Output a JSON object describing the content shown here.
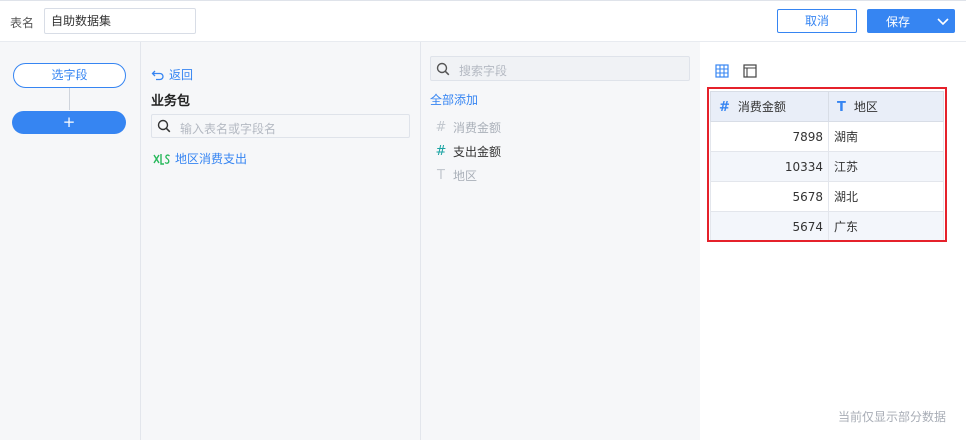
{
  "header": {
    "table_name_label": "表名",
    "table_name_value": "自助数据集",
    "cancel_label": "取消",
    "save_label": "保存"
  },
  "steps": {
    "select_fields_label": "选字段",
    "add_label": "+"
  },
  "package": {
    "back_label": "返回",
    "title": "业务包",
    "search_placeholder": "输入表名或字段名",
    "tables": [
      {
        "name": "地区消费支出",
        "icon": "excel-table-icon"
      }
    ]
  },
  "fields": {
    "search_placeholder": "搜索字段",
    "add_all_label": "全部添加",
    "items": [
      {
        "type": "#",
        "name": "消费金额",
        "state": "disabled"
      },
      {
        "type": "#",
        "name": "支出金额",
        "state": "enabled"
      },
      {
        "type": "T",
        "name": "地区",
        "state": "disabled"
      }
    ]
  },
  "preview": {
    "columns": [
      {
        "type": "#",
        "name": "消费金额"
      },
      {
        "type": "T",
        "name": "地区"
      }
    ],
    "rows": [
      [
        "7898",
        "湖南"
      ],
      [
        "10334",
        "江苏"
      ],
      [
        "5678",
        "湖北"
      ],
      [
        "5674",
        "广东"
      ]
    ],
    "footnote": "当前仅显示部分数据"
  },
  "colors": {
    "accent": "#3685f2",
    "highlight_border": "#e5212b",
    "excel_green": "#26b85a",
    "teal_symbol": "#1aa3a3"
  }
}
